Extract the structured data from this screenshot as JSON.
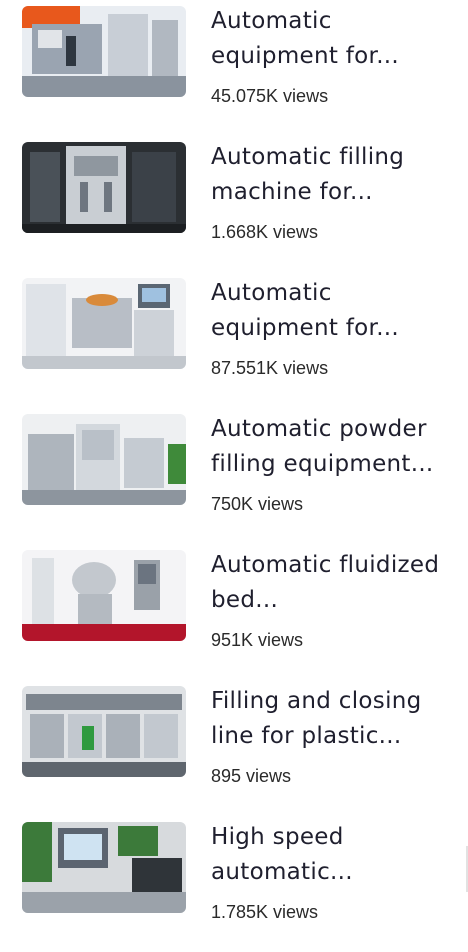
{
  "videos": [
    {
      "title": "Automatic equipment for...",
      "views": "45.075K views",
      "thumbnail_icon": "machine-thumbnail",
      "palette": [
        "#e9edf2",
        "#9aa4b1",
        "#e8581c"
      ]
    },
    {
      "title": "Automatic filling machine for...",
      "views": "1.668K views",
      "thumbnail_icon": "machine-thumbnail",
      "palette": [
        "#2b2f33",
        "#c9ced3",
        "#6e7680"
      ]
    },
    {
      "title": "Automatic equipment for...",
      "views": "87.551K views",
      "thumbnail_icon": "machine-thumbnail",
      "palette": [
        "#f2f3f5",
        "#b8bec6",
        "#d98a3a"
      ]
    },
    {
      "title": "Automatic powder filling equipment...",
      "views": "750K views",
      "thumbnail_icon": "machine-thumbnail",
      "palette": [
        "#eef0f2",
        "#aeb5bd",
        "#3f8a3a"
      ]
    },
    {
      "title": "Automatic fluidized bed...",
      "views": "951K views",
      "thumbnail_icon": "machine-thumbnail",
      "palette": [
        "#f4f4f6",
        "#c3c8ce",
        "#b3152b"
      ]
    },
    {
      "title": "Filling and closing line for plastic...",
      "views": "895 views",
      "thumbnail_icon": "machine-thumbnail",
      "palette": [
        "#dfe2e5",
        "#7d858e",
        "#2f9a3f"
      ]
    },
    {
      "title": "High speed automatic...",
      "views": "1.785K views",
      "thumbnail_icon": "machine-thumbnail",
      "palette": [
        "#3c7a3a",
        "#d7dadd",
        "#5b6470"
      ]
    }
  ]
}
